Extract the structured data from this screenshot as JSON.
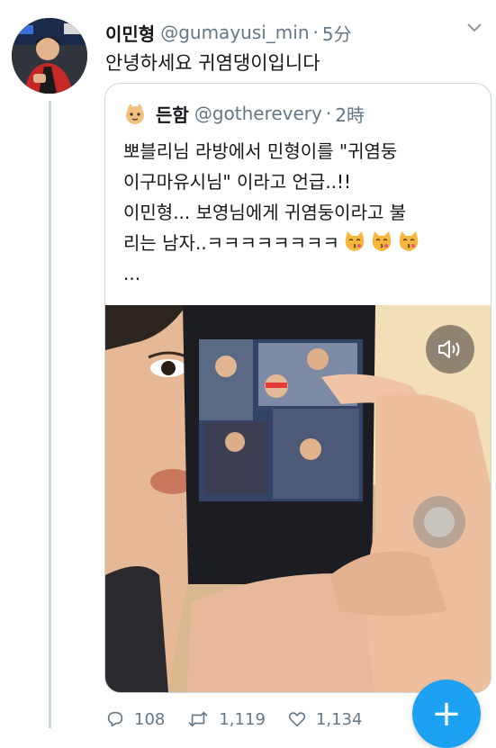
{
  "tweet": {
    "author_name": "이민형",
    "handle": "@gumayusi_min",
    "separator": "·",
    "time": "5分",
    "text": "안녕하세요 귀염댕이입니다"
  },
  "quoted": {
    "author_name": "든함",
    "handle": "@gotherevery",
    "separator": "·",
    "time": "2時",
    "lines": [
      "뽀블리님 라방에서 민형이를 \"귀염둥",
      "이구마유시님\" 이라고 언급..!!",
      "이민형... 보영님에게 귀염둥이라고 불",
      "리는 남자..ㅋㅋㅋㅋㅋㅋㅋㅋ",
      "..."
    ],
    "emoji_count": 3
  },
  "actions": {
    "replies": "108",
    "retweets": "1,119",
    "likes": "1,134"
  },
  "fab_label": "+",
  "colors": {
    "accent": "#1da1f2",
    "muted": "#657786",
    "border": "#ccd6dd"
  },
  "icons": [
    "chevron-down-icon",
    "speaker-icon",
    "reply-icon",
    "retweet-icon",
    "heart-icon",
    "compose-icon"
  ]
}
